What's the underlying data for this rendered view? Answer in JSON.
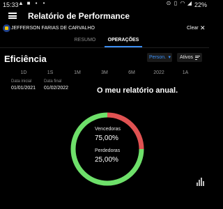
{
  "status_bar": {
    "time": "15:33",
    "battery": "22%"
  },
  "header": {
    "title": "Relatório de Performance"
  },
  "user": {
    "name": "JEFFERSON FARIAS DE CARVALHO",
    "clear_label": "Clear"
  },
  "tabs": [
    {
      "label": "RESUMO",
      "active": false
    },
    {
      "label": "OPERAÇÕES",
      "active": true
    }
  ],
  "efficiency": {
    "title": "Eficiência",
    "person_select": "Person.",
    "ativos_label": "Ativos",
    "periods": [
      "1D",
      "1S",
      "1M",
      "3M",
      "6M",
      "2022",
      "1A"
    ],
    "start_date": {
      "label": "Data inicial",
      "value": "01/01/2021"
    },
    "end_date": {
      "label": "Data final",
      "value": "01/02/2022"
    }
  },
  "annotation": "O meu relatório anual.",
  "donut": {
    "winners_label": "Vencedoras",
    "winners_value": "75,00%",
    "losers_label": "Perdedoras",
    "losers_value": "25,00%"
  },
  "chart_data": {
    "type": "pie",
    "categories": [
      "Vencedoras",
      "Perdedoras"
    ],
    "values": [
      75.0,
      25.0
    ],
    "colors": [
      "#6ee06a",
      "#e05252"
    ]
  },
  "colors": {
    "accent": "#3b8ef3",
    "win": "#6ee06a",
    "loss": "#e05252",
    "background": "#000000"
  }
}
